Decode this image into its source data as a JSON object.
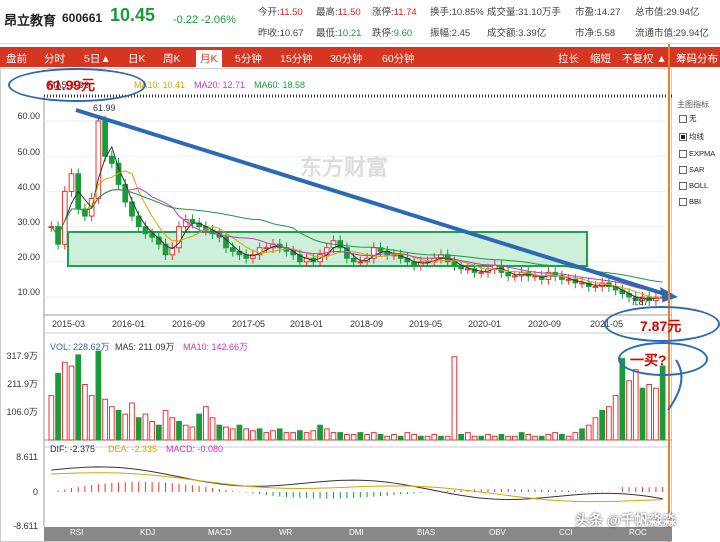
{
  "header": {
    "stock_name": "昂立教育",
    "stock_code": "600661",
    "price": "10.45",
    "change": "-0.22",
    "change_pct": "-2.06%",
    "row1": [
      [
        "今开:",
        "11.50"
      ],
      [
        "最高:",
        "11.50"
      ],
      [
        "涨停:",
        "11.74"
      ],
      [
        "换手:",
        "10.85%"
      ],
      [
        "成交量:",
        "31.10万手"
      ],
      [
        "市盈:",
        "14.27"
      ],
      [
        "总市值:",
        "29.94亿"
      ]
    ],
    "row2": [
      [
        "昨收:",
        "10.67"
      ],
      [
        "最低:",
        "10.21"
      ],
      [
        "跌停:",
        "9.60"
      ],
      [
        "振幅:",
        "2.45"
      ],
      [
        "成交额:",
        "3.39亿"
      ],
      [
        "市净:",
        "5.58"
      ],
      [
        "流通市值:",
        "29.94亿"
      ]
    ]
  },
  "nav": {
    "items": [
      "盘前",
      "分时",
      "5日▲",
      "日K",
      "周K",
      "月K",
      "5分钟",
      "15分钟",
      "30分钟",
      "60分钟"
    ],
    "right": [
      "拉长",
      "缩短",
      "不复权 ▲",
      "筹码分布"
    ]
  },
  "price_chart": {
    "ma_labels": [
      "MA5: 9.93",
      "MA10: 10.41",
      "MA20: 12.71",
      "MA60: 18.58"
    ],
    "yticks": [
      "60.00",
      "50.00",
      "40.00",
      "30.00",
      "20.00",
      "10.00"
    ],
    "high_label": "61.99",
    "low_label": "7.87"
  },
  "xaxis": [
    "2015-03",
    "2016-01",
    "2016-09",
    "2017-05",
    "2018-01",
    "2018-09",
    "2019-05",
    "2020-01",
    "2020-09",
    "2021-05"
  ],
  "volume": {
    "labels": [
      "VOL: 228.62万",
      "MA5: 211.09万",
      "MA10: 142.66万"
    ],
    "yticks": [
      "317.9万",
      "211.9万",
      "106.0万"
    ]
  },
  "macd": {
    "labels": [
      "DIF: -2.375",
      "DEA: -2.335",
      "MACD: -0.080"
    ],
    "yticks": [
      "8.611",
      "0",
      "-8.611"
    ]
  },
  "indicator_tabs": [
    "RSI",
    "KDJ",
    "MACD",
    "WR",
    "DMI",
    "BIAS",
    "OBV",
    "CCI",
    "ROC"
  ],
  "sidebar": {
    "title": "主图指标",
    "items": [
      "无",
      "均线",
      "EXPMA",
      "SAR",
      "BOLL",
      "BBI"
    ]
  },
  "watermark": "东方财富",
  "annotations": {
    "top_price": "61.99元",
    "bottom_price": "7.87元",
    "question": "一买?",
    "credit": "头条 @千帆淼淼"
  },
  "chart_data": {
    "type": "candlestick",
    "categories": [
      "2015-03",
      "2016-01",
      "2016-09",
      "2017-05",
      "2018-01",
      "2018-09",
      "2019-05",
      "2020-01",
      "2020-09",
      "2021-05"
    ],
    "high": 61.99,
    "low": 7.87,
    "last": 10.45,
    "ylim": [
      0,
      65
    ]
  }
}
